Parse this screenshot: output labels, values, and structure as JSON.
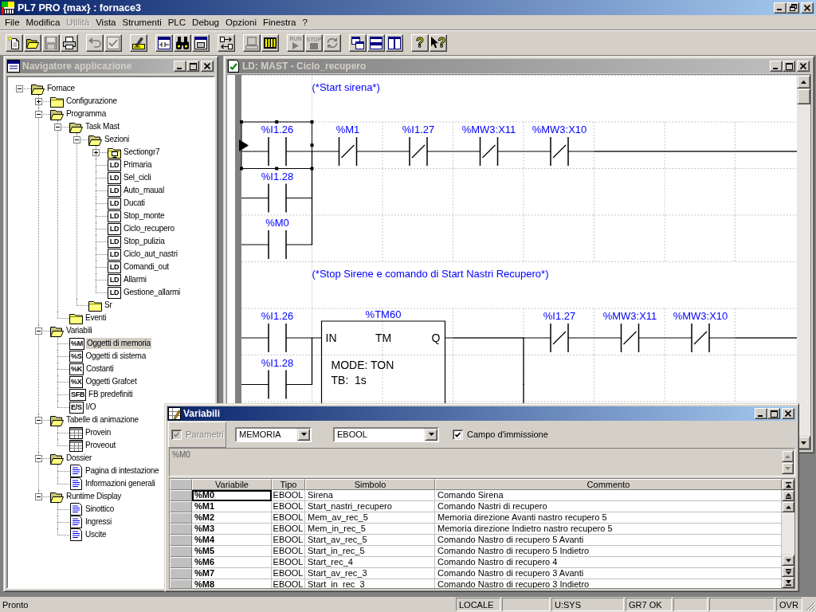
{
  "app": {
    "title": "PL7 PRO {max} : fornace3"
  },
  "menu": [
    {
      "label": "File",
      "disabled": false
    },
    {
      "label": "Modifica",
      "disabled": false
    },
    {
      "label": "Utilità",
      "disabled": true
    },
    {
      "label": "Vista",
      "disabled": false
    },
    {
      "label": "Strumenti",
      "disabled": false
    },
    {
      "label": "PLC",
      "disabled": false
    },
    {
      "label": "Debug",
      "disabled": false
    },
    {
      "label": "Opzioni",
      "disabled": false
    },
    {
      "label": "Finestra",
      "disabled": false
    },
    {
      "label": "?",
      "disabled": false
    }
  ],
  "toolbar": [
    [
      {
        "disabled": false
      },
      {
        "disabled": false
      },
      {
        "disabled": true
      },
      {
        "disabled": false
      }
    ],
    [
      {
        "disabled": true
      },
      {
        "disabled": true
      }
    ],
    [
      {
        "disabled": false
      }
    ],
    [
      {
        "disabled": false
      },
      {
        "disabled": false
      },
      {
        "disabled": false
      }
    ],
    [
      {
        "disabled": false
      }
    ],
    [
      {
        "disabled": true
      },
      {
        "disabled": false
      }
    ],
    [
      {
        "label": "RUN",
        "disabled": true
      },
      {
        "label": "STOP",
        "disabled": true
      },
      {
        "disabled": true
      }
    ],
    [
      {
        "disabled": false
      },
      {
        "disabled": false
      },
      {
        "disabled": false
      }
    ],
    [
      {
        "label": "?",
        "disabled": false
      },
      {
        "label": "?",
        "disabled": false
      }
    ]
  ],
  "navigator": {
    "title": "Navigatore applicazione",
    "active": false,
    "tree": [
      {
        "label": "Fornace",
        "kind": "folder",
        "expanded": true,
        "selected": false,
        "children": [
          {
            "label": "Configurazione",
            "kind": "folder",
            "expanded": false,
            "selected": false
          },
          {
            "label": "Programma",
            "kind": "folder",
            "expanded": true,
            "selected": false,
            "children": [
              {
                "label": "Task Mast",
                "kind": "folder",
                "expanded": true,
                "selected": false,
                "children": [
                  {
                    "label": "Sezioni",
                    "kind": "folder",
                    "expanded": true,
                    "selected": false,
                    "children": [
                      {
                        "label": "Sectiongr7",
                        "kind": "section",
                        "expanded": false,
                        "selected": false
                      },
                      {
                        "label": "Primaria",
                        "kind": "badge",
                        "badge": "LD",
                        "selected": false
                      },
                      {
                        "label": "Sel_cicli",
                        "kind": "badge",
                        "badge": "LD",
                        "selected": false
                      },
                      {
                        "label": "Auto_maual",
                        "kind": "badge",
                        "badge": "LD",
                        "selected": false
                      },
                      {
                        "label": "Ducati",
                        "kind": "badge",
                        "badge": "LD",
                        "selected": false
                      },
                      {
                        "label": "Stop_monte",
                        "kind": "badge",
                        "badge": "LD",
                        "selected": false
                      },
                      {
                        "label": "Ciclo_recupero",
                        "kind": "badge",
                        "badge": "LD",
                        "selected": false
                      },
                      {
                        "label": "Stop_pulizia",
                        "kind": "badge",
                        "badge": "LD",
                        "selected": false
                      },
                      {
                        "label": "Ciclo_aut_nastri",
                        "kind": "badge",
                        "badge": "LD",
                        "selected": false
                      },
                      {
                        "label": "Comandi_out",
                        "kind": "badge",
                        "badge": "LD",
                        "selected": false
                      },
                      {
                        "label": "Allarmi",
                        "kind": "badge",
                        "badge": "LD",
                        "selected": false
                      },
                      {
                        "label": "Gestione_allarmi",
                        "kind": "badge",
                        "badge": "LD",
                        "selected": false
                      }
                    ]
                  },
                  {
                    "label": "Sr",
                    "kind": "folder",
                    "selected": false
                  }
                ]
              },
              {
                "label": "Eventi",
                "kind": "folder",
                "selected": false
              }
            ]
          },
          {
            "label": "Variabili",
            "kind": "folder",
            "expanded": true,
            "selected": false,
            "children": [
              {
                "label": "Oggetti di memoria",
                "kind": "badge",
                "badge": "%M",
                "selected": true
              },
              {
                "label": "Oggetti di sistema",
                "kind": "badge",
                "badge": "%S",
                "selected": false
              },
              {
                "label": "Costanti",
                "kind": "badge",
                "badge": "%K",
                "selected": false
              },
              {
                "label": "Oggetti Grafcet",
                "kind": "badge",
                "badge": "%X",
                "selected": false
              },
              {
                "label": "FB predefiniti",
                "kind": "badge",
                "badge": "SFB",
                "selected": false
              },
              {
                "label": "I/O",
                "kind": "badge",
                "badge": "E/S",
                "selected": false
              }
            ]
          },
          {
            "label": "Tabelle di animazione",
            "kind": "folder",
            "expanded": true,
            "selected": false,
            "children": [
              {
                "label": "Provein",
                "kind": "table",
                "selected": false
              },
              {
                "label": "Proveout",
                "kind": "table",
                "selected": false
              }
            ]
          },
          {
            "label": "Dossier",
            "kind": "folder",
            "expanded": true,
            "selected": false,
            "children": [
              {
                "label": "Pagina di intestazione",
                "kind": "document",
                "selected": false
              },
              {
                "label": "Informazioni generali",
                "kind": "document",
                "selected": false
              }
            ]
          },
          {
            "label": "Runtime Display",
            "kind": "folder",
            "expanded": true,
            "selected": false,
            "children": [
              {
                "label": "Sinottico",
                "kind": "document",
                "selected": false
              },
              {
                "label": "Ingressi",
                "kind": "document",
                "selected": false
              },
              {
                "label": "Uscite",
                "kind": "document",
                "selected": false
              }
            ]
          }
        ]
      }
    ]
  },
  "ld_editor": {
    "title": "LD: MAST - Ciclo_recupero",
    "active": false,
    "rungs": [
      {
        "comment": "(*Start sirena*)",
        "rows": [
          [
            {
              "kind": "contact_no",
              "label": "%I1.26",
              "selected": true,
              "link_down": true
            },
            {
              "kind": "contact_nc",
              "label": "%M1",
              "selected": false
            },
            {
              "kind": "contact_nc",
              "label": "%I1.27",
              "selected": false
            },
            {
              "kind": "contact_nc",
              "label": "%MW3:X11",
              "selected": false
            },
            {
              "kind": "contact_nc",
              "label": "%MW3:X10",
              "selected": false
            },
            {
              "kind": "wire",
              "selected": false
            },
            {
              "kind": "wire",
              "selected": false
            },
            {
              "kind": "wire",
              "selected": false
            }
          ],
          [
            {
              "kind": "contact_no",
              "label": "%I1.28",
              "selected": false,
              "link_down": true
            }
          ],
          [
            {
              "kind": "contact_no",
              "label": "%M0",
              "selected": false
            }
          ]
        ]
      },
      {
        "comment": "(*Stop Sirene e comando di Start Nastri Recupero*)",
        "rows": [
          [
            {
              "kind": "contact_no",
              "label": "%I1.26",
              "selected": false,
              "link_down": true
            },
            {
              "kind": "block",
              "label": "%TM60",
              "type": "TM",
              "input": "IN",
              "output": "Q",
              "params": [
                "MODE: TON",
                "TB:  1s"
              ],
              "selected": false
            },
            {
              "kind": "wire",
              "selected": false,
              "link_down": true
            },
            {
              "kind": "contact_nc",
              "label": "%I1.27",
              "selected": false
            },
            {
              "kind": "contact_nc",
              "label": "%MW3:X11",
              "selected": false
            },
            {
              "kind": "contact_nc",
              "label": "%MW3:X10",
              "selected": false
            },
            {
              "kind": "wire",
              "selected": false
            }
          ],
          [
            {
              "kind": "contact_no",
              "label": "%I1.28",
              "selected": false
            },
            {
              "kind": "empty"
            },
            {
              "kind": "empty"
            },
            {
              "kind": "empty",
              "link_down": true
            }
          ]
        ]
      }
    ]
  },
  "variables_window": {
    "title": "Variabili",
    "active": true,
    "params_checkbox": {
      "label": "Parametri",
      "checked": true,
      "disabled": true
    },
    "memory_dropdown": {
      "value": "MEMORIA"
    },
    "type_dropdown": {
      "value": "EBOOL"
    },
    "entry_checkbox": {
      "label": "Campo d'immissione",
      "checked": true,
      "disabled": false
    },
    "entry_field": {
      "value": "%M0",
      "disabled": true
    },
    "table": {
      "columns": [
        "Variabile",
        "Tipo",
        "Simbolo",
        "Commento"
      ],
      "rows": [
        {
          "variable": "%M0",
          "type": "EBOOL",
          "symbol": "Sirena",
          "comment": "Comando Sirena",
          "selected": false,
          "focused": true
        },
        {
          "variable": "%M1",
          "type": "EBOOL",
          "symbol": "Start_nastri_recupero",
          "comment": "Comando Nastri di recupero",
          "selected": false,
          "focused": false
        },
        {
          "variable": "%M2",
          "type": "EBOOL",
          "symbol": "Mem_av_rec_5",
          "comment": "Memoria direzione Avanti nastro recupero 5",
          "selected": false,
          "focused": false
        },
        {
          "variable": "%M3",
          "type": "EBOOL",
          "symbol": "Mem_in_rec_5",
          "comment": "Memoria direzione Indietro nastro recupero 5",
          "selected": false,
          "focused": false
        },
        {
          "variable": "%M4",
          "type": "EBOOL",
          "symbol": "Start_av_rec_5",
          "comment": "Comando Nastro di recupero 5 Avanti",
          "selected": false,
          "focused": false
        },
        {
          "variable": "%M5",
          "type": "EBOOL",
          "symbol": "Start_in_rec_5",
          "comment": "Comando Nastro di recupero 5 Indietro",
          "selected": false,
          "focused": false
        },
        {
          "variable": "%M6",
          "type": "EBOOL",
          "symbol": "Start_rec_4",
          "comment": "Comando Nastro di recupero 4",
          "selected": false,
          "focused": false
        },
        {
          "variable": "%M7",
          "type": "EBOOL",
          "symbol": "Start_av_rec_3",
          "comment": "Comando Nastro di recupero 3 Avanti",
          "selected": false,
          "focused": false
        },
        {
          "variable": "%M8",
          "type": "EBOOL",
          "symbol": "Start_in_rec_3",
          "comment": "Comando Nastro di recupero 3 Indietro",
          "selected": false,
          "focused": false
        }
      ]
    }
  },
  "status_bar": {
    "message": "Pronto",
    "panels": [
      {
        "kind": "text",
        "text": "LOCALE"
      },
      {
        "kind": "empty"
      },
      {
        "kind": "text",
        "text": "U:SYS"
      },
      {
        "kind": "text",
        "text": "GR7 OK"
      },
      {
        "kind": "empty"
      },
      {
        "kind": "empty"
      },
      {
        "kind": "text",
        "text": "OVR"
      }
    ]
  }
}
